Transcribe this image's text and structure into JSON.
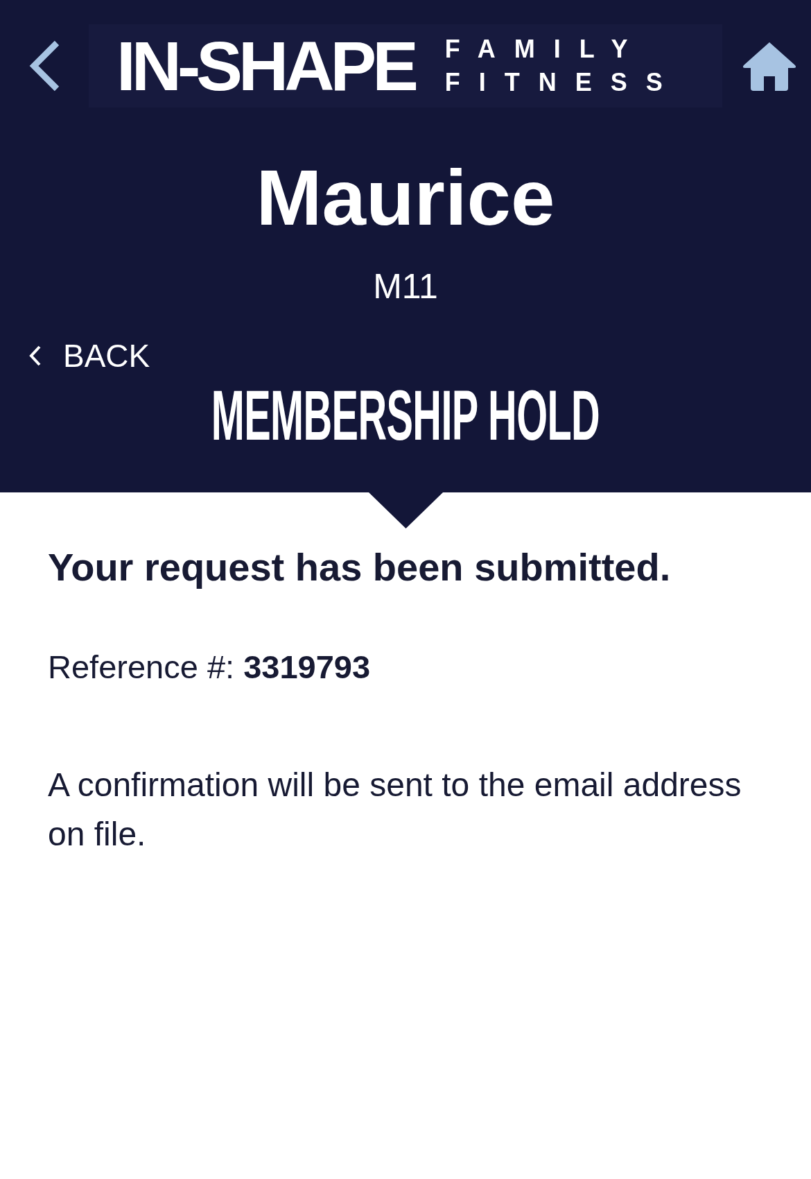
{
  "logo": {
    "wordmark": "IN-SHAPE",
    "tagline": [
      "FAMILY",
      "FITNESS"
    ]
  },
  "member": {
    "name": "Maurice",
    "code": "M11"
  },
  "back_link": {
    "label": "BACK"
  },
  "page_title": "MEMBERSHIP HOLD",
  "confirmation": {
    "heading": "Your request has been submitted.",
    "reference": "Reference #: **3319793**",
    "message": "A confirmation will be sent to the email address on file."
  }
}
